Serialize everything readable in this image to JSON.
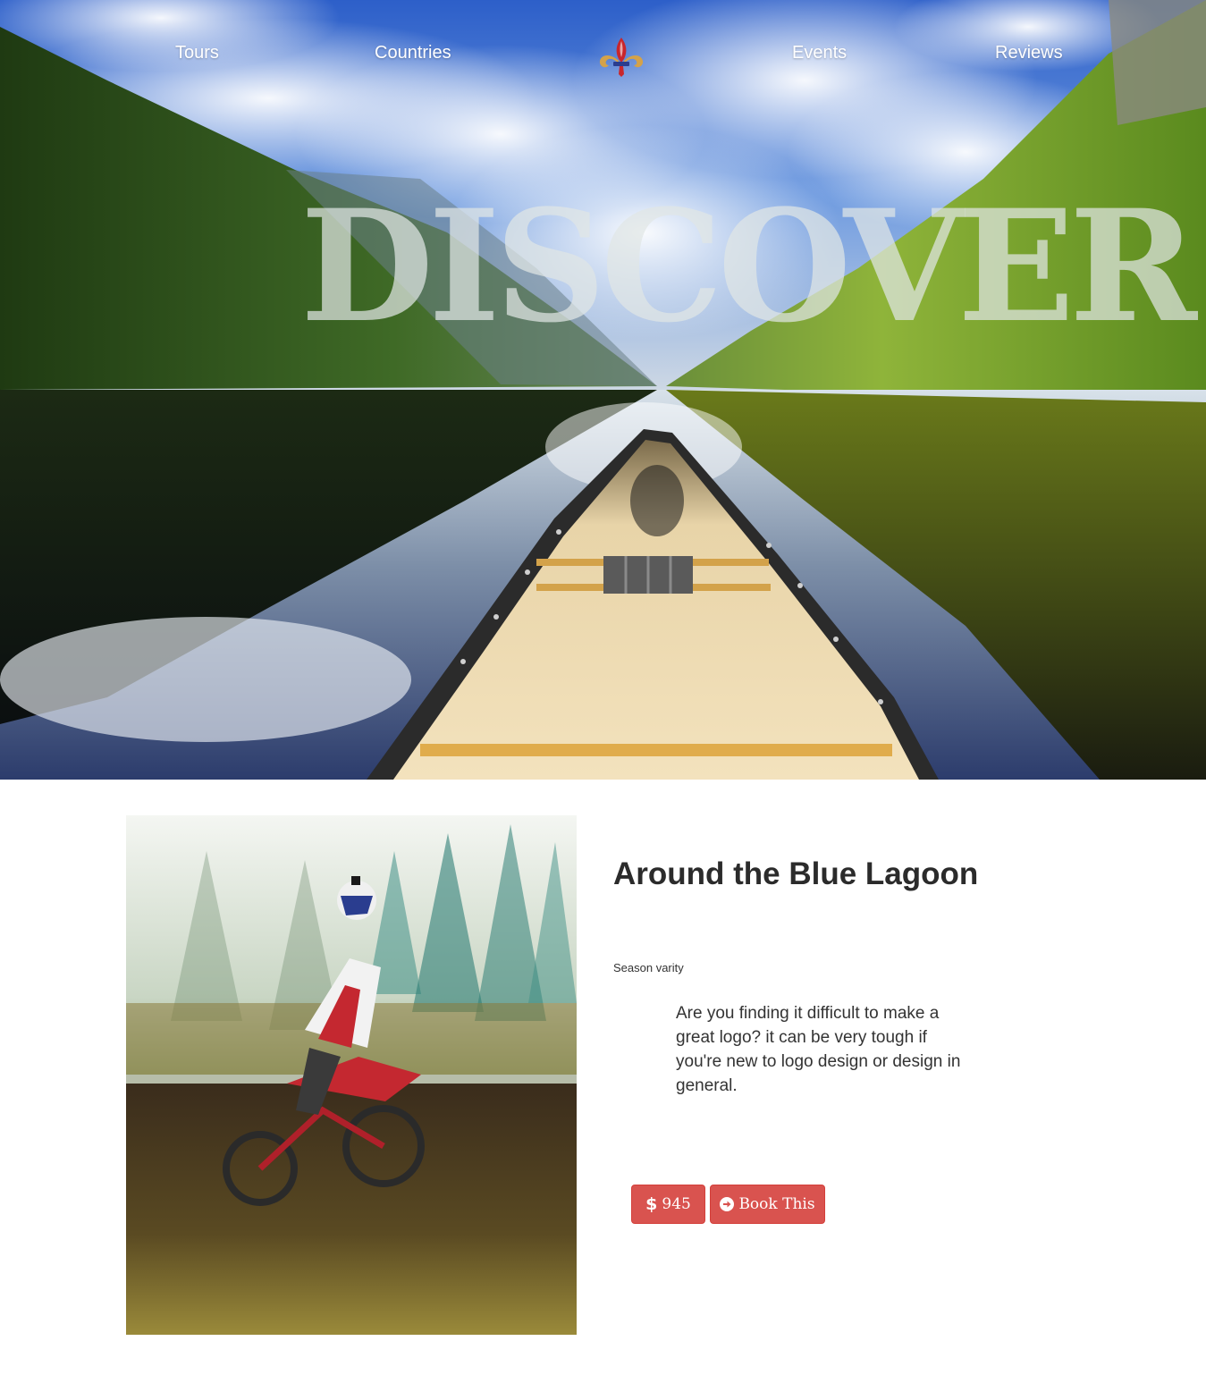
{
  "nav": {
    "links": [
      "Tours",
      "Countries",
      "Events",
      "Reviews"
    ],
    "logo_icon": "fleur-de-lis-icon"
  },
  "hero": {
    "title": "DISCOVER"
  },
  "tour": {
    "title": "Around the Blue Lagoon",
    "season": "Season varity",
    "description": "Are you finding it difficult to make a great logo? it can be very tough if you're new to logo design or design in general.",
    "price_symbol": "$",
    "price": "945",
    "book_label": "Book This",
    "book_icon": "arrow-circle-right-icon",
    "price_icon": "dollar-icon",
    "accent_color": "#d9534f"
  }
}
